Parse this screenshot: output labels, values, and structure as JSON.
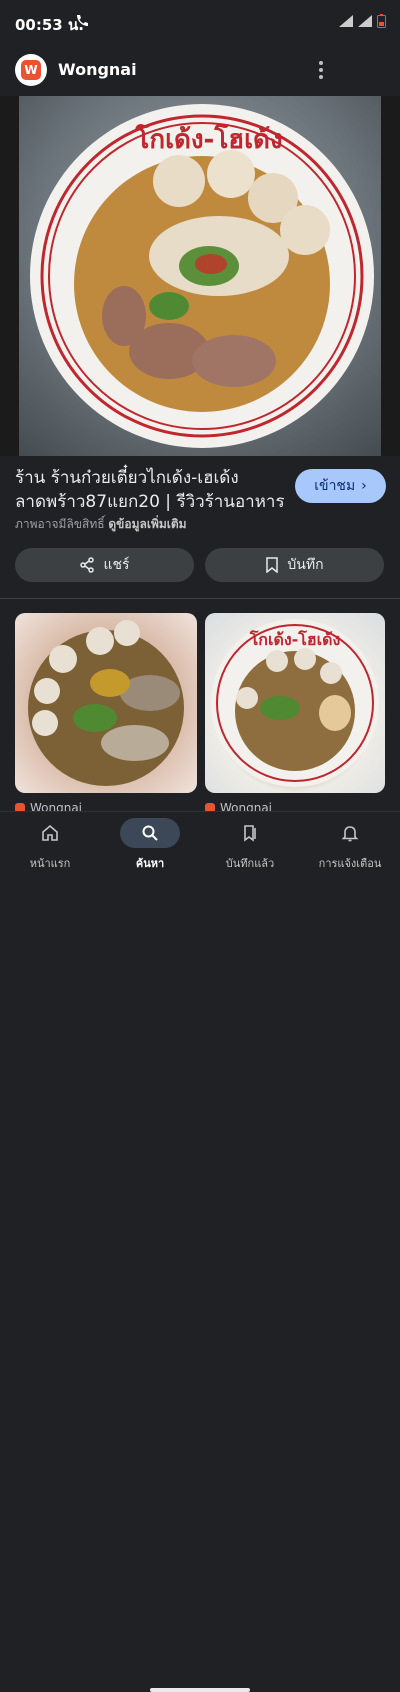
{
  "status_bar": {
    "time": "00:53 น."
  },
  "header": {
    "app_name": "Wongnai"
  },
  "result": {
    "title": "ร้าน ร้านก๋วยเตี๋ยวไกเด้ง-เฮเด้ง ลาดพร้าว87แยก20 | รีวิวร้านอาหาร",
    "visit_label": "เข้าชม",
    "caption_prefix": "ภาพอาจมีลิขสิทธิ์",
    "caption_link": "ดูข้อมูลเพิ่มเติม",
    "bowl_rim_text": "โกเด้ง-โฮเด้ง"
  },
  "actions": {
    "share_label": "แชร์",
    "save_label": "บันทึก"
  },
  "related": [
    {
      "source": "Wongnai",
      "bowl_text": ""
    },
    {
      "source": "Wongnai",
      "bowl_text": "โกเด้ง-โฮเด้ง"
    }
  ],
  "bottom_nav": [
    {
      "label": "หน้าแรก",
      "icon": "home-icon",
      "active": false
    },
    {
      "label": "ค้นหา",
      "icon": "search-icon",
      "active": true
    },
    {
      "label": "บันทึกแล้ว",
      "icon": "saved-icon",
      "active": false
    },
    {
      "label": "การแจ้งเตือน",
      "icon": "bell-icon",
      "active": false
    }
  ],
  "colors": {
    "accent": "#a8c7fa",
    "brand": "#e8542f",
    "background": "#202124"
  }
}
